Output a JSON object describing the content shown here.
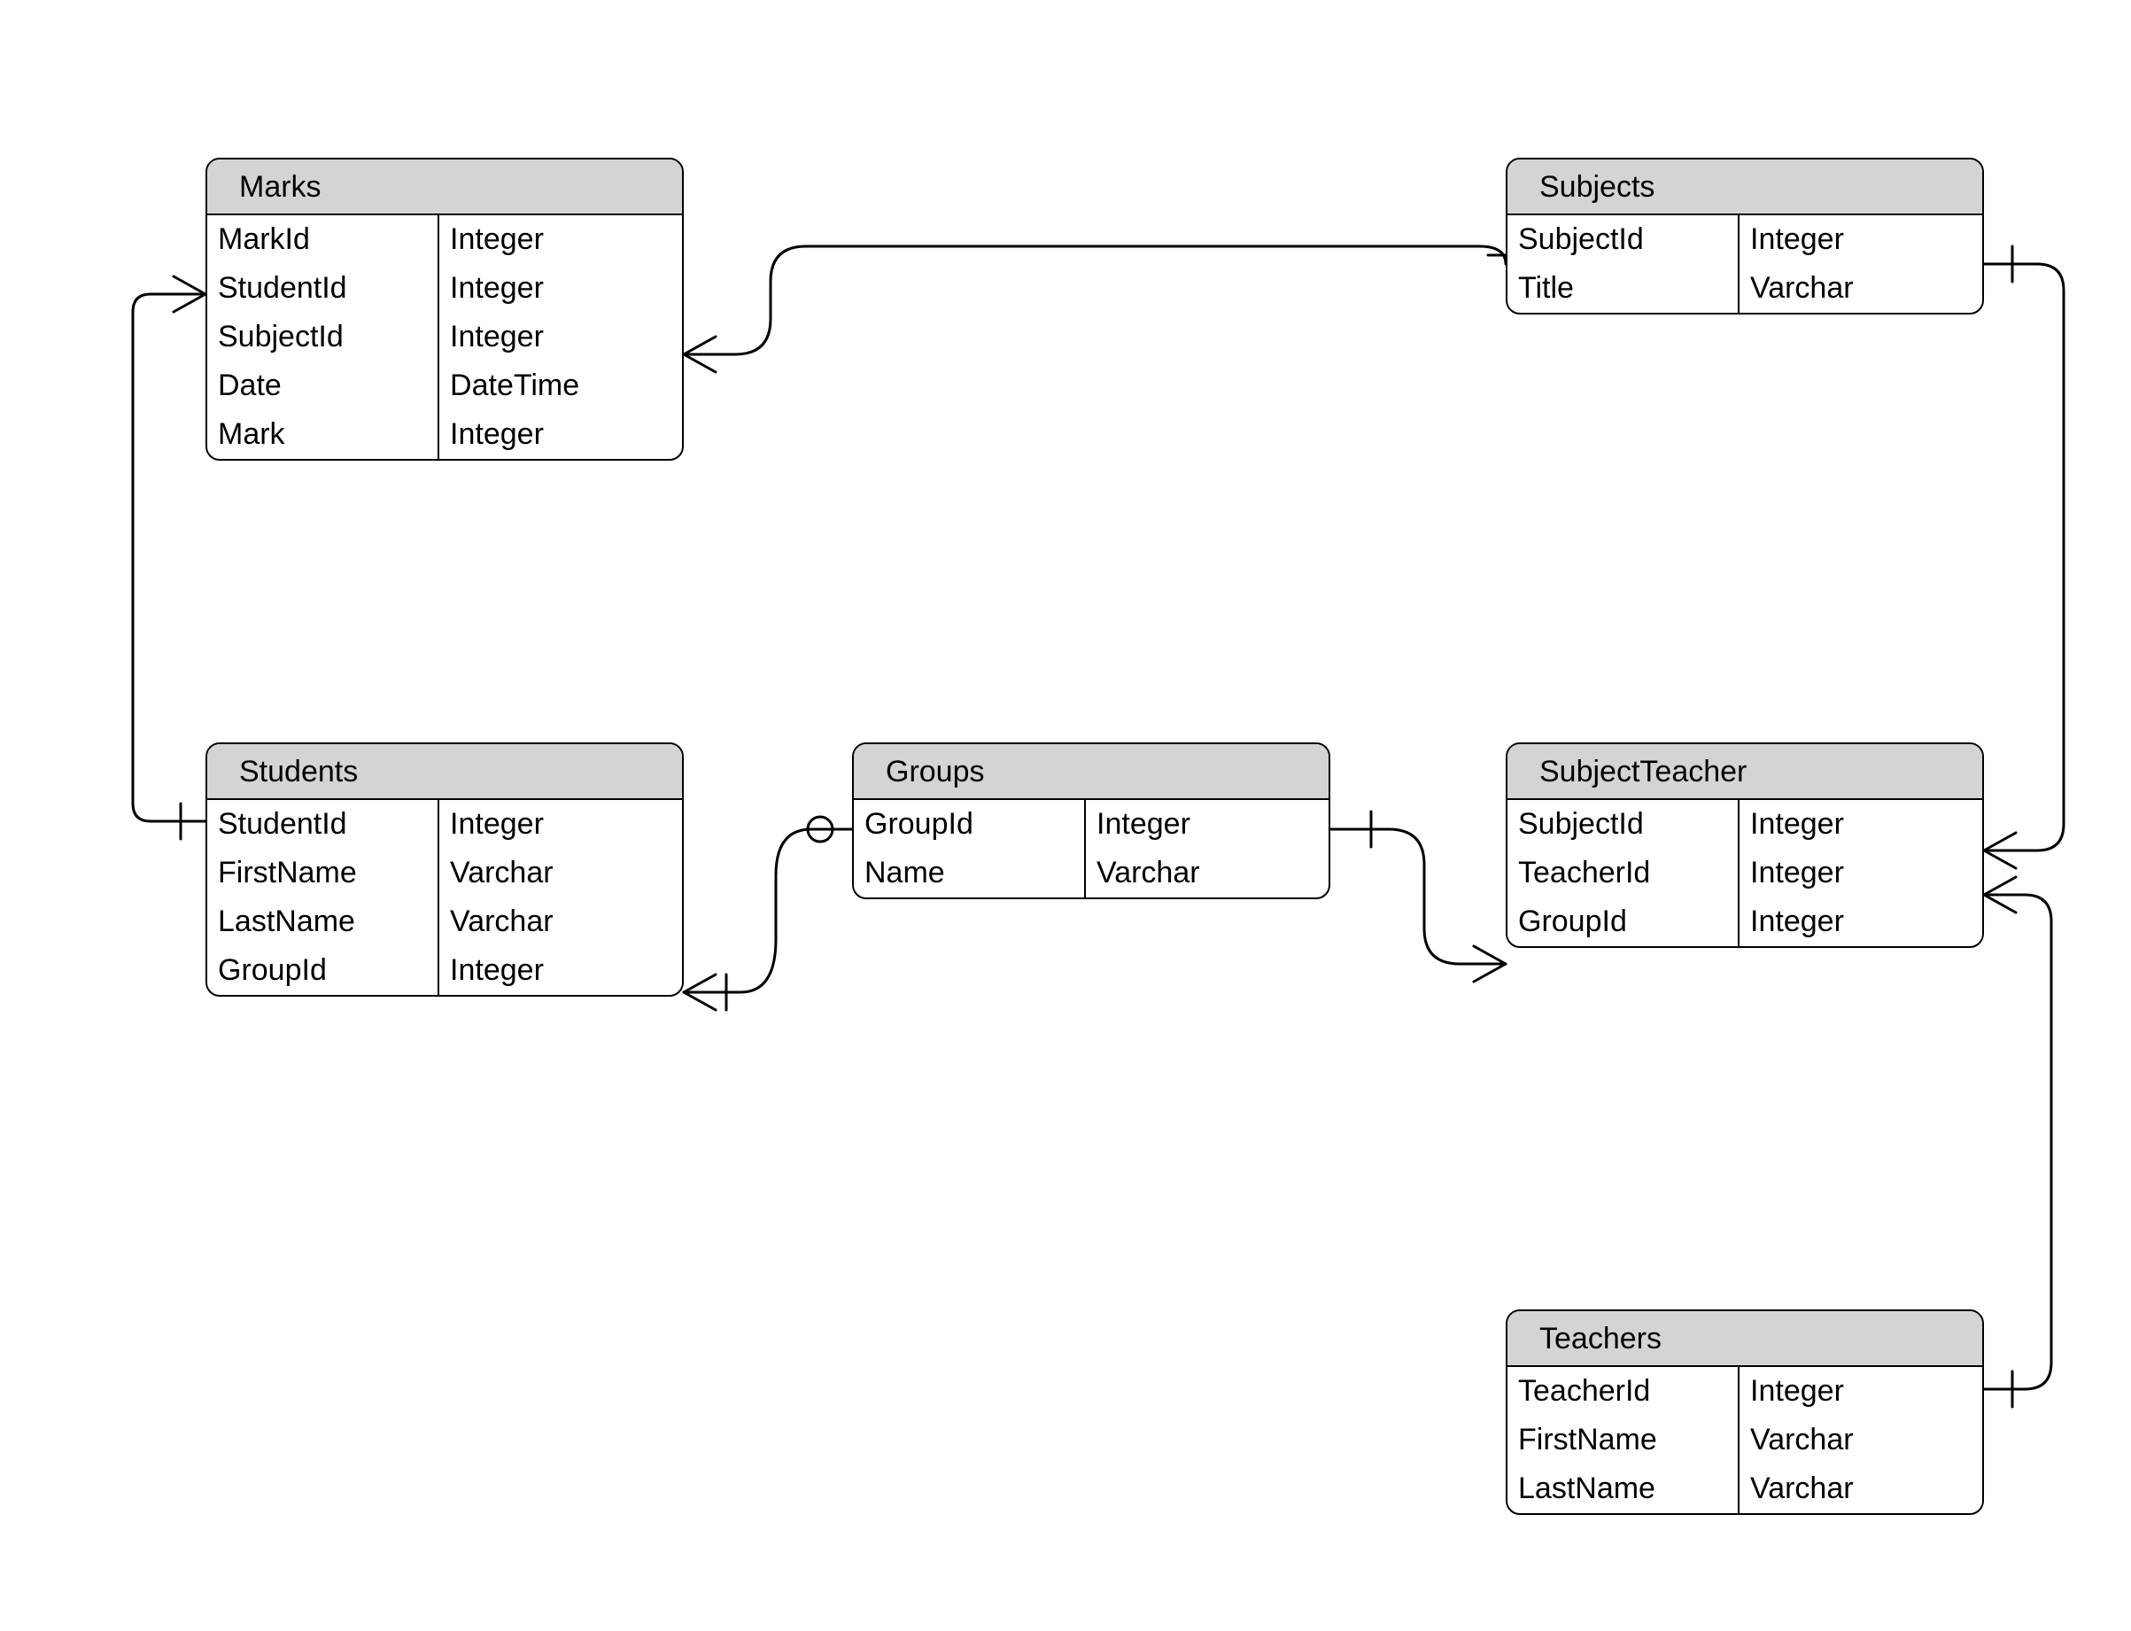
{
  "diagram_type": "entity-relationship",
  "entities": {
    "marks": {
      "title": "Marks",
      "fields": [
        {
          "name": "MarkId",
          "type": "Integer"
        },
        {
          "name": "StudentId",
          "type": "Integer"
        },
        {
          "name": "SubjectId",
          "type": "Integer"
        },
        {
          "name": "Date",
          "type": "DateTime"
        },
        {
          "name": "Mark",
          "type": "Integer"
        }
      ]
    },
    "students": {
      "title": "Students",
      "fields": [
        {
          "name": "StudentId",
          "type": "Integer"
        },
        {
          "name": "FirstName",
          "type": "Varchar"
        },
        {
          "name": "LastName",
          "type": "Varchar"
        },
        {
          "name": "GroupId",
          "type": "Integer"
        }
      ]
    },
    "groups": {
      "title": "Groups",
      "fields": [
        {
          "name": "GroupId",
          "type": "Integer"
        },
        {
          "name": "Name",
          "type": "Varchar"
        }
      ]
    },
    "subjects": {
      "title": "Subjects",
      "fields": [
        {
          "name": "SubjectId",
          "type": "Integer"
        },
        {
          "name": "Title",
          "type": "Varchar"
        }
      ]
    },
    "subjectTeacher": {
      "title": "SubjectTeacher",
      "fields": [
        {
          "name": "SubjectId",
          "type": "Integer"
        },
        {
          "name": "TeacherId",
          "type": "Integer"
        },
        {
          "name": "GroupId",
          "type": "Integer"
        }
      ]
    },
    "teachers": {
      "title": "Teachers",
      "fields": [
        {
          "name": "TeacherId",
          "type": "Integer"
        },
        {
          "name": "FirstName",
          "type": "Varchar"
        },
        {
          "name": "LastName",
          "type": "Varchar"
        }
      ]
    }
  },
  "relationships": [
    {
      "from": "Students.StudentId",
      "to": "Marks.StudentId",
      "cardinality_from": "one",
      "cardinality_to": "many"
    },
    {
      "from": "Subjects.SubjectId",
      "to": "Marks.SubjectId",
      "cardinality_from": "one",
      "cardinality_to": "many"
    },
    {
      "from": "Groups.GroupId",
      "to": "Students.GroupId",
      "cardinality_from": "zero-or-one",
      "cardinality_to": "one-or-many"
    },
    {
      "from": "Groups.GroupId",
      "to": "SubjectTeacher.GroupId",
      "cardinality_from": "one",
      "cardinality_to": "many"
    },
    {
      "from": "Subjects.SubjectId",
      "to": "SubjectTeacher.SubjectId",
      "cardinality_from": "one",
      "cardinality_to": "many"
    },
    {
      "from": "Teachers.TeacherId",
      "to": "SubjectTeacher.TeacherId",
      "cardinality_from": "one",
      "cardinality_to": "many"
    }
  ]
}
